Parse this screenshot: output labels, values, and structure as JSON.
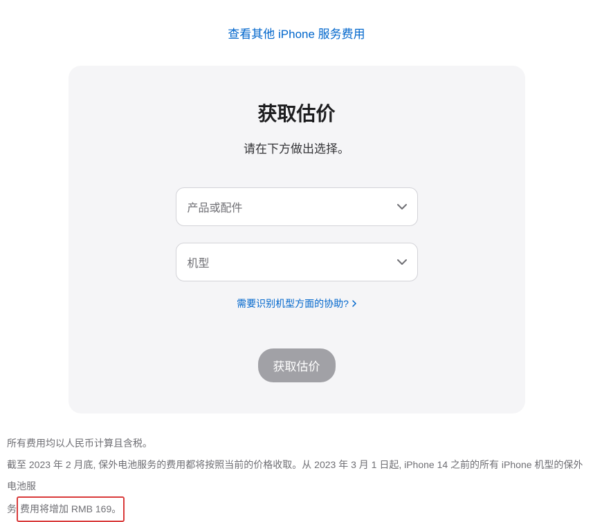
{
  "topLink": {
    "label": "查看其他 iPhone 服务费用"
  },
  "card": {
    "title": "获取估价",
    "subtitle": "请在下方做出选择。",
    "productSelect": {
      "placeholder": "产品或配件"
    },
    "modelSelect": {
      "placeholder": "机型"
    },
    "helpLink": {
      "label": "需要识别机型方面的协助?"
    },
    "submit": {
      "label": "获取估价"
    }
  },
  "footer": {
    "line1": "所有费用均以人民币计算且含税。",
    "line2a": "截至 2023 年 2 月底, 保外电池服务的费用都将按照当前的价格收取。从 2023 年 3 月 1 日起, iPhone 14 之前的所有 iPhone 机型的保外电池服",
    "line2b": "务",
    "highlighted": "费用将增加 RMB 169。"
  }
}
